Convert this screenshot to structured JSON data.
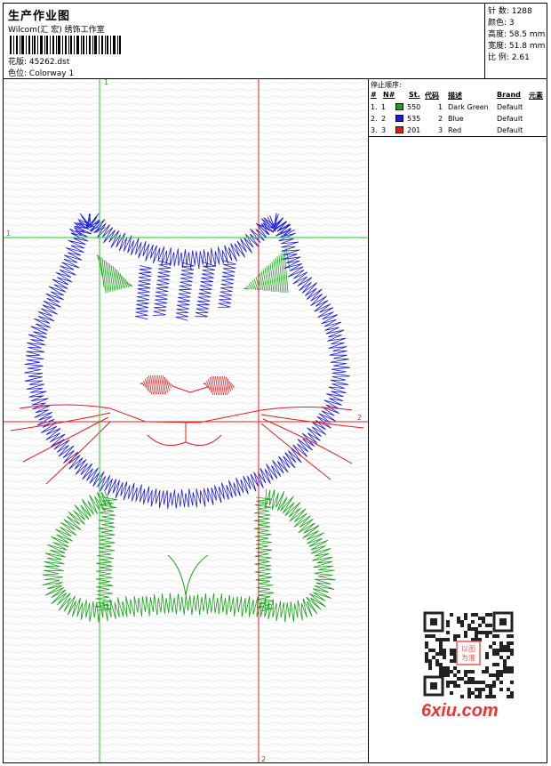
{
  "header": {
    "title": "生产作业图",
    "company": "Wilcom(汇 宏) 绣饰工作室",
    "design_label": "花版:",
    "design_value": "45262.dst",
    "colorway_label": "色位:",
    "colorway_value": "Colorway 1"
  },
  "stats": [
    {
      "label": "针 数:",
      "value": "1288"
    },
    {
      "label": "颜色:",
      "value": "3"
    },
    {
      "label": "高度:",
      "value": "58.5 mm"
    },
    {
      "label": "宽度:",
      "value": "51.8 mm"
    },
    {
      "label": "比 例:",
      "value": "2.61"
    }
  ],
  "panel": {
    "title": "停止顺序:",
    "headers": {
      "num": "#",
      "n": "N#",
      "st": "St.",
      "code": "代码",
      "desc": "描述",
      "brand": "Brand",
      "elem": "元素"
    },
    "rows": [
      {
        "num": "1.",
        "n": "1",
        "st": "550",
        "code": "1",
        "desc": "Dark Green",
        "brand": "Default",
        "color": "#17a017"
      },
      {
        "num": "2.",
        "n": "2",
        "st": "535",
        "code": "2",
        "desc": "Blue",
        "brand": "Default",
        "color": "#1a1ae6"
      },
      {
        "num": "3.",
        "n": "3",
        "st": "201",
        "code": "3",
        "desc": "Red",
        "brand": "Default",
        "color": "#e61a1a"
      }
    ]
  },
  "guides": {
    "green_v": "1",
    "green_h": "1",
    "red_v": "2",
    "red_h": "2"
  },
  "watermark": "6xiu.com",
  "qr_logo": "以图为准",
  "colors": {
    "green": "#17a017",
    "blue": "#1a1ae6",
    "red": "#e61a1a",
    "guide_green": "#22cc22",
    "guide_red": "#dd2222"
  }
}
